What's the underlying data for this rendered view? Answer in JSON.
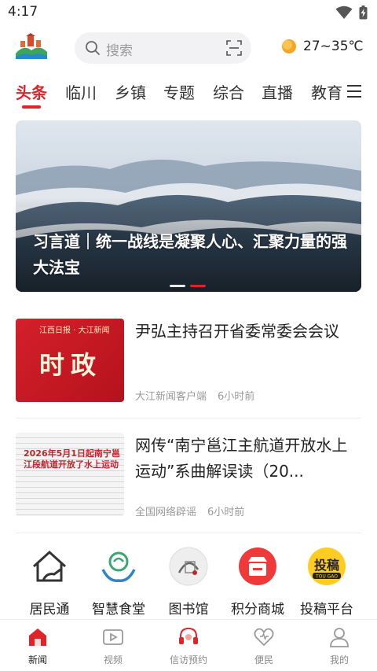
{
  "status_bar": {
    "time": "4:17"
  },
  "header": {
    "search_placeholder": "搜索",
    "weather": "27~35℃"
  },
  "tabs": [
    {
      "label": "头条",
      "active": true
    },
    {
      "label": "临川"
    },
    {
      "label": "乡镇"
    },
    {
      "label": "专题"
    },
    {
      "label": "综合"
    },
    {
      "label": "直播"
    },
    {
      "label": "教育"
    }
  ],
  "banner": {
    "title": "习言道｜统一战线是凝聚人心、汇聚力量的强大法宝",
    "dots": 2,
    "active_dot": 1
  },
  "news": [
    {
      "title": "尹弘主持召开省委常委会会议",
      "source": "大江新闻客户端",
      "time": "6小时前",
      "thumb_label": "时政",
      "thumb_brand": "江西日报 · 大江新闻"
    },
    {
      "title": "网传“南宁邕江主航道开放水上运动”系曲解误读（20...",
      "source": "全国网络辟谣",
      "time": "6小时前",
      "thumb_stamp": "2026年5月1日起南宁邕江段航道开放了水上运动"
    }
  ],
  "quick_access": [
    {
      "label": "居民通",
      "icon": "house-icon"
    },
    {
      "label": "智慧食堂",
      "icon": "canteen-icon"
    },
    {
      "label": "图书馆",
      "icon": "library-icon"
    },
    {
      "label": "积分商城",
      "icon": "points-mall-icon"
    },
    {
      "label": "投稿平台",
      "icon": "submission-icon",
      "icon_text": "投稿",
      "icon_subtext": "TOU GAO"
    }
  ],
  "bottom_nav": [
    {
      "label": "新闻",
      "active": true
    },
    {
      "label": "视频"
    },
    {
      "label": "信访预约"
    },
    {
      "label": "便民"
    },
    {
      "label": "我的"
    }
  ],
  "colors": {
    "accent": "#e0232b",
    "text": "#222222",
    "muted": "#9a9a9a"
  }
}
